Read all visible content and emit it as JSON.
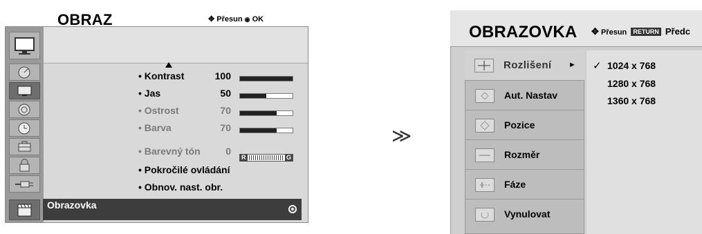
{
  "left_menu": {
    "title": "OBRAZ",
    "hint_move": "Přesun",
    "hint_ok": "OK",
    "items": [
      {
        "label": "• Kontrast",
        "value": "100",
        "level": 100,
        "dim": false
      },
      {
        "label": "• Jas",
        "value": "50",
        "level": 50,
        "dim": false
      },
      {
        "label": "• Ostrost",
        "value": "70",
        "level": 70,
        "dim": true
      },
      {
        "label": "• Barva",
        "value": "70",
        "level": 70,
        "dim": true
      },
      {
        "label": "• Barevný tón",
        "value": "0",
        "dim": true
      },
      {
        "label": "• Pokročilé ovládání"
      },
      {
        "label": "• Obnov. nast. obr."
      }
    ],
    "tint_left": "R",
    "tint_right": "G",
    "footer_label": "Obrazovka",
    "sidebar_icons": [
      "tv-icon",
      "satellite-dish-icon",
      "monitor-icon",
      "speaker-icon",
      "clock-icon",
      "toolbox-icon",
      "lock-icon",
      "plug-icon",
      "clapperboard-icon"
    ]
  },
  "arrow_glyph": "≫",
  "right_menu": {
    "title": "OBRAZOVKA",
    "hint_move": "Přesun",
    "hint_return": "RETURN",
    "hint_prev": "Předc",
    "items": [
      {
        "label": "Rozlišení",
        "icon": "crosshair-icon",
        "selected": true
      },
      {
        "label": "Aut. Nastav",
        "icon": "auto-adjust-icon"
      },
      {
        "label": "Pozice",
        "icon": "position-icon"
      },
      {
        "label": "Rozměr",
        "icon": "size-icon"
      },
      {
        "label": "Fáze",
        "icon": "phase-icon"
      },
      {
        "label": "Vynulovat",
        "icon": "reset-icon"
      }
    ],
    "resolutions": [
      "1024 x 768",
      "1280 x 768",
      "1360 x 768"
    ],
    "selected_resolution": "1024 x 768",
    "arrow_right": "►",
    "check": "✓"
  }
}
